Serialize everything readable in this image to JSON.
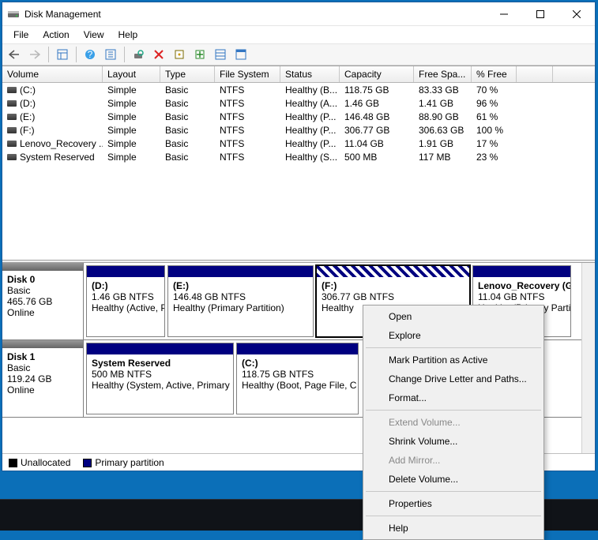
{
  "window": {
    "title": "Disk Management"
  },
  "menu": {
    "file": "File",
    "action": "Action",
    "view": "View",
    "help": "Help"
  },
  "columns": {
    "volume": "Volume",
    "layout": "Layout",
    "type": "Type",
    "fs": "File System",
    "status": "Status",
    "capacity": "Capacity",
    "free": "Free Spa...",
    "pct": "% Free"
  },
  "colw": {
    "volume": 127,
    "layout": 73,
    "type": 69,
    "fs": 83,
    "status": 75,
    "capacity": 94,
    "free": 73,
    "pct": 57,
    "tail": 46
  },
  "volumes": [
    {
      "name": "(C:)",
      "layout": "Simple",
      "type": "Basic",
      "fs": "NTFS",
      "status": "Healthy (B...",
      "cap": "118.75 GB",
      "free": "83.33 GB",
      "pct": "70 %"
    },
    {
      "name": "(D:)",
      "layout": "Simple",
      "type": "Basic",
      "fs": "NTFS",
      "status": "Healthy (A...",
      "cap": "1.46 GB",
      "free": "1.41 GB",
      "pct": "96 %"
    },
    {
      "name": "(E:)",
      "layout": "Simple",
      "type": "Basic",
      "fs": "NTFS",
      "status": "Healthy (P...",
      "cap": "146.48 GB",
      "free": "88.90 GB",
      "pct": "61 %"
    },
    {
      "name": "(F:)",
      "layout": "Simple",
      "type": "Basic",
      "fs": "NTFS",
      "status": "Healthy (P...",
      "cap": "306.77 GB",
      "free": "306.63 GB",
      "pct": "100 %"
    },
    {
      "name": "Lenovo_Recovery ...",
      "layout": "Simple",
      "type": "Basic",
      "fs": "NTFS",
      "status": "Healthy (P...",
      "cap": "11.04 GB",
      "free": "1.91 GB",
      "pct": "17 %"
    },
    {
      "name": "System Reserved",
      "layout": "Simple",
      "type": "Basic",
      "fs": "NTFS",
      "status": "Healthy (S...",
      "cap": "500 MB",
      "free": "117 MB",
      "pct": "23 %"
    }
  ],
  "disks": [
    {
      "label": "Disk 0",
      "type": "Basic",
      "size": "465.76 GB",
      "state": "Online",
      "parts": [
        {
          "title": "(D:)",
          "line2": "1.46 GB NTFS",
          "line3": "Healthy (Active, P",
          "w": 100,
          "sel": false
        },
        {
          "title": "(E:)",
          "line2": "146.48 GB NTFS",
          "line3": "Healthy (Primary Partition)",
          "w": 185,
          "sel": false
        },
        {
          "title": "(F:)",
          "line2": "306.77 GB NTFS",
          "line3": "Healthy",
          "w": 195,
          "sel": true
        },
        {
          "title": "Lenovo_Recovery  (G:)",
          "line2": "11.04 GB NTFS",
          "line3": "Healthy (Primary Partitic",
          "w": 125,
          "sel": false
        }
      ]
    },
    {
      "label": "Disk 1",
      "type": "Basic",
      "size": "119.24 GB",
      "state": "Online",
      "parts": [
        {
          "title": "System Reserved",
          "line2": "500 MB NTFS",
          "line3": "Healthy (System, Active, Primary F",
          "w": 187,
          "sel": false
        },
        {
          "title": "(C:)",
          "line2": "118.75 GB NTFS",
          "line3": "Healthy (Boot, Page File, C",
          "w": 155,
          "sel": false
        }
      ]
    }
  ],
  "legend": {
    "unalloc": "Unallocated",
    "primary": "Primary partition"
  },
  "context": {
    "open": "Open",
    "explore": "Explore",
    "mark": "Mark Partition as Active",
    "change": "Change Drive Letter and Paths...",
    "format": "Format...",
    "extend": "Extend Volume...",
    "shrink": "Shrink Volume...",
    "mirror": "Add Mirror...",
    "delete": "Delete Volume...",
    "props": "Properties",
    "help": "Help"
  }
}
